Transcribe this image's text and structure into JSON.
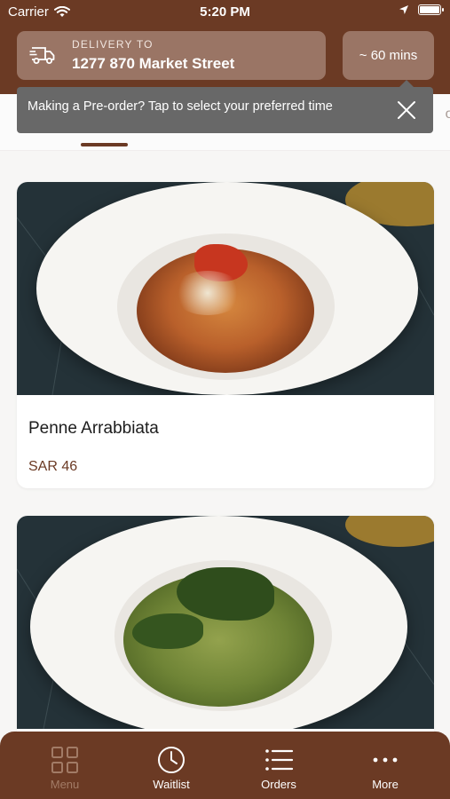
{
  "status_bar": {
    "carrier": "Carrier",
    "time": "5:20 PM"
  },
  "header": {
    "delivery_label": "DELIVERY TO",
    "delivery_address": "1277 870 Market Street",
    "eta": "~ 60 mins"
  },
  "tooltip": {
    "text": "Making a Pre-order? Tap to select your preferred time"
  },
  "tabs": {
    "partial_label": "of"
  },
  "menu_items": [
    {
      "name": "Penne Arrabbiata",
      "price": "SAR 46",
      "image_icon": "penne-arrabbiata-photo"
    },
    {
      "name": "",
      "price": "",
      "image_icon": "pesto-fusilli-photo"
    }
  ],
  "bottom_nav": [
    {
      "label": "Menu",
      "icon": "grid-icon",
      "active": true
    },
    {
      "label": "Waitlist",
      "icon": "clock-icon",
      "active": false
    },
    {
      "label": "Orders",
      "icon": "list-icon",
      "active": false
    },
    {
      "label": "More",
      "icon": "more-icon",
      "active": false
    }
  ],
  "colors": {
    "brand": "#6b3a24",
    "header_box": "#9a7565",
    "active_nav": "#a27b66",
    "tooltip_bg": "#686868"
  }
}
